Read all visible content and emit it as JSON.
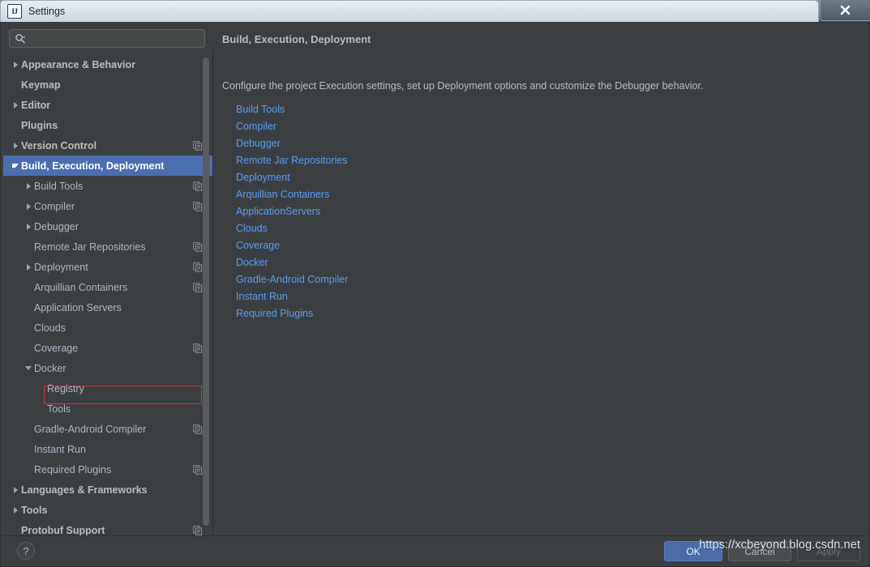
{
  "window": {
    "app_icon": "intellij-idea-icon",
    "title": "Settings",
    "close_label": "✕"
  },
  "search": {
    "icon": "search-icon",
    "value": "",
    "placeholder": ""
  },
  "sidebar": {
    "items": [
      {
        "label": "Appearance & Behavior",
        "depth": 0,
        "arrow": "right",
        "bold": true,
        "scope_icon": false,
        "selected": false
      },
      {
        "label": "Keymap",
        "depth": 0,
        "arrow": "none",
        "bold": true,
        "scope_icon": false,
        "selected": false
      },
      {
        "label": "Editor",
        "depth": 0,
        "arrow": "right",
        "bold": true,
        "scope_icon": false,
        "selected": false
      },
      {
        "label": "Plugins",
        "depth": 0,
        "arrow": "none",
        "bold": true,
        "scope_icon": false,
        "selected": false
      },
      {
        "label": "Version Control",
        "depth": 0,
        "arrow": "right",
        "bold": true,
        "scope_icon": true,
        "selected": false
      },
      {
        "label": "Build, Execution, Deployment",
        "depth": 0,
        "arrow": "down",
        "bold": true,
        "scope_icon": false,
        "selected": true
      },
      {
        "label": "Build Tools",
        "depth": 1,
        "arrow": "right",
        "bold": false,
        "scope_icon": true,
        "selected": false
      },
      {
        "label": "Compiler",
        "depth": 1,
        "arrow": "right",
        "bold": false,
        "scope_icon": true,
        "selected": false
      },
      {
        "label": "Debugger",
        "depth": 1,
        "arrow": "right",
        "bold": false,
        "scope_icon": false,
        "selected": false
      },
      {
        "label": "Remote Jar Repositories",
        "depth": 1,
        "arrow": "none",
        "bold": false,
        "scope_icon": true,
        "selected": false
      },
      {
        "label": "Deployment",
        "depth": 1,
        "arrow": "right",
        "bold": false,
        "scope_icon": true,
        "selected": false
      },
      {
        "label": "Arquillian Containers",
        "depth": 1,
        "arrow": "none",
        "bold": false,
        "scope_icon": true,
        "selected": false
      },
      {
        "label": "Application Servers",
        "depth": 1,
        "arrow": "none",
        "bold": false,
        "scope_icon": false,
        "selected": false
      },
      {
        "label": "Clouds",
        "depth": 1,
        "arrow": "none",
        "bold": false,
        "scope_icon": false,
        "selected": false
      },
      {
        "label": "Coverage",
        "depth": 1,
        "arrow": "none",
        "bold": false,
        "scope_icon": true,
        "selected": false
      },
      {
        "label": "Docker",
        "depth": 1,
        "arrow": "down",
        "bold": false,
        "scope_icon": false,
        "selected": false
      },
      {
        "label": "Registry",
        "depth": 2,
        "arrow": "none",
        "bold": false,
        "scope_icon": false,
        "selected": false
      },
      {
        "label": "Tools",
        "depth": 2,
        "arrow": "none",
        "bold": false,
        "scope_icon": false,
        "selected": false
      },
      {
        "label": "Gradle-Android Compiler",
        "depth": 1,
        "arrow": "none",
        "bold": false,
        "scope_icon": true,
        "selected": false
      },
      {
        "label": "Instant Run",
        "depth": 1,
        "arrow": "none",
        "bold": false,
        "scope_icon": false,
        "selected": false
      },
      {
        "label": "Required Plugins",
        "depth": 1,
        "arrow": "none",
        "bold": false,
        "scope_icon": true,
        "selected": false
      },
      {
        "label": "Languages & Frameworks",
        "depth": 0,
        "arrow": "right",
        "bold": true,
        "scope_icon": false,
        "selected": false
      },
      {
        "label": "Tools",
        "depth": 0,
        "arrow": "right",
        "bold": true,
        "scope_icon": false,
        "selected": false
      },
      {
        "label": "Protobuf Support",
        "depth": 0,
        "arrow": "none",
        "bold": true,
        "scope_icon": true,
        "selected": false
      }
    ],
    "highlight": {
      "target": "Docker",
      "color": "#e03131"
    }
  },
  "content": {
    "title": "Build, Execution, Deployment",
    "description": "Configure the project Execution settings, set up Deployment options and customize the Debugger behavior.",
    "links": [
      "Build Tools",
      "Compiler",
      "Debugger",
      "Remote Jar Repositories",
      "Deployment",
      "Arquillian Containers",
      "ApplicationServers",
      "Clouds",
      "Coverage",
      "Docker",
      "Gradle-Android Compiler",
      "Instant Run",
      "Required Plugins"
    ],
    "link_color": "#589df6"
  },
  "bottom": {
    "help_label": "?",
    "ok_label": "OK",
    "cancel_label": "Cancel",
    "apply_label": "Apply"
  },
  "watermark": {
    "text": "https://xcbeyond.blog.csdn.net"
  },
  "theme": {
    "panel_bg": "#3c3f41",
    "selection_blue": "#4b6eaf",
    "text": "#bbbbbb",
    "tree_text": "#a9b7c6"
  }
}
